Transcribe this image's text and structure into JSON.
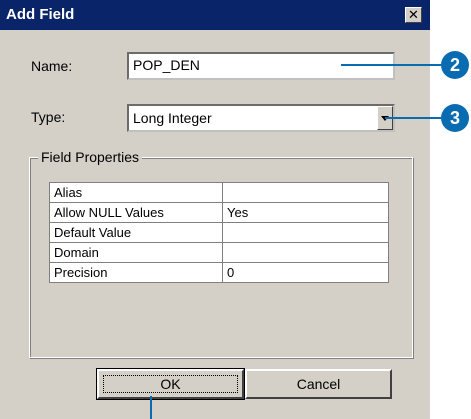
{
  "dialog": {
    "title": "Add Field",
    "close_label": "✕",
    "name_label": "Name:",
    "name_value": "POP_DEN",
    "type_label": "Type:",
    "type_value": "Long Integer",
    "group_label": "Field Properties",
    "properties": [
      {
        "key": "Alias",
        "value": ""
      },
      {
        "key": "Allow NULL Values",
        "value": "Yes"
      },
      {
        "key": "Default Value",
        "value": ""
      },
      {
        "key": "Domain",
        "value": ""
      },
      {
        "key": "Precision",
        "value": "0"
      }
    ],
    "ok_label": "OK",
    "cancel_label": "Cancel"
  },
  "callouts": {
    "c2": "2",
    "c3": "3"
  },
  "colors": {
    "titlebar": "#0a246a",
    "callout": "#0a6cb0",
    "dialog_bg": "#d4d0c8"
  }
}
